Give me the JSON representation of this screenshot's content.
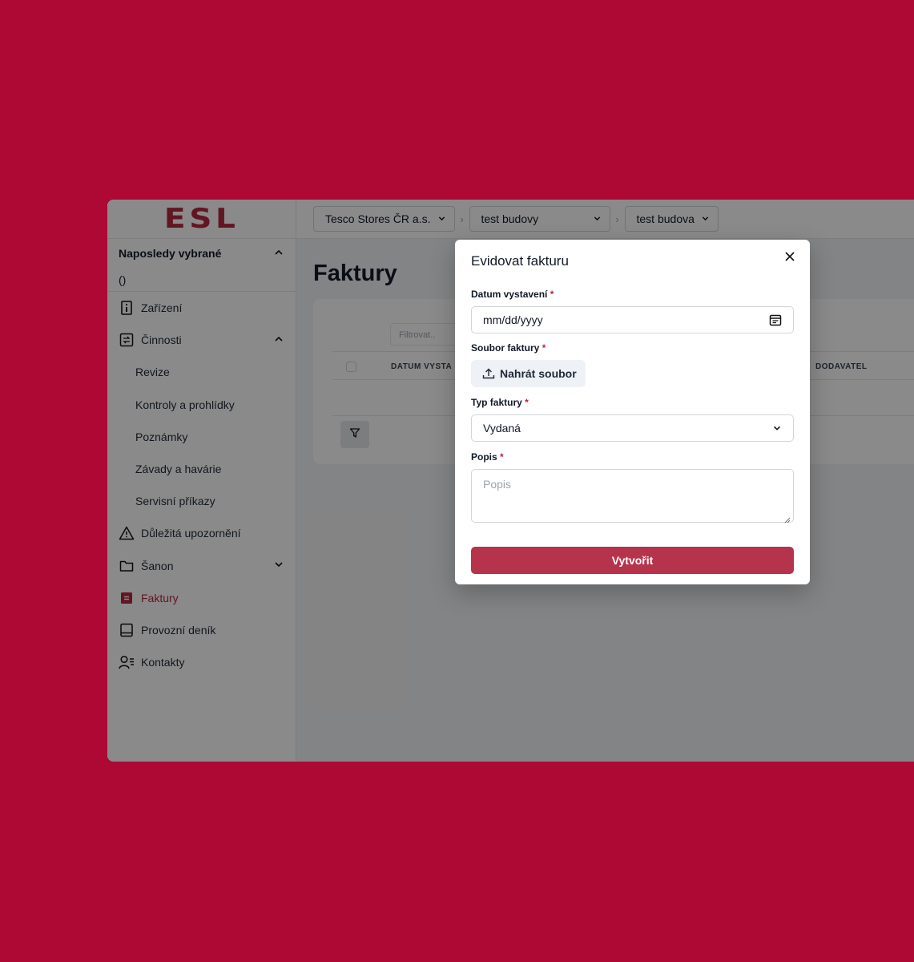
{
  "logo": "ESL",
  "sidebar": {
    "recent_header": "Naposledy vybrané",
    "recent_value": "()",
    "items": [
      {
        "label": "Zařízení",
        "icon": "device-icon"
      },
      {
        "label": "Činnosti",
        "icon": "activities-icon"
      },
      {
        "label": "Revize"
      },
      {
        "label": "Kontroly a prohlídky"
      },
      {
        "label": "Poznámky"
      },
      {
        "label": "Závady a havárie"
      },
      {
        "label": "Servisní příkazy"
      },
      {
        "label": "Důležitá upozornění",
        "icon": "warning-icon"
      },
      {
        "label": "Šanon",
        "icon": "folder-icon"
      },
      {
        "label": "Faktury",
        "icon": "invoice-icon",
        "active": true
      },
      {
        "label": "Provozní deník",
        "icon": "book-icon"
      },
      {
        "label": "Kontakty",
        "icon": "contacts-icon"
      }
    ]
  },
  "breadcrumbs": [
    "Tesco Stores ČR a.s.",
    "test budovy",
    "test budova"
  ],
  "page": {
    "title": "Faktury",
    "filter_placeholder": "Filtrovat..",
    "columns": [
      "DATUM VYSTA",
      "DODAVATEL"
    ]
  },
  "modal": {
    "title": "Evidovat fakturu",
    "date_label": "Datum vystavení",
    "date_value": "mm/dd/yyyy",
    "file_label": "Soubor faktury",
    "upload_button": "Nahrát soubor",
    "type_label": "Typ faktury",
    "type_value": "Vydaná",
    "desc_label": "Popis",
    "desc_placeholder": "Popis",
    "required_mark": "*",
    "submit": "Vytvořit"
  },
  "colors": {
    "brand": "#b5283f",
    "background": "#ad0934"
  }
}
